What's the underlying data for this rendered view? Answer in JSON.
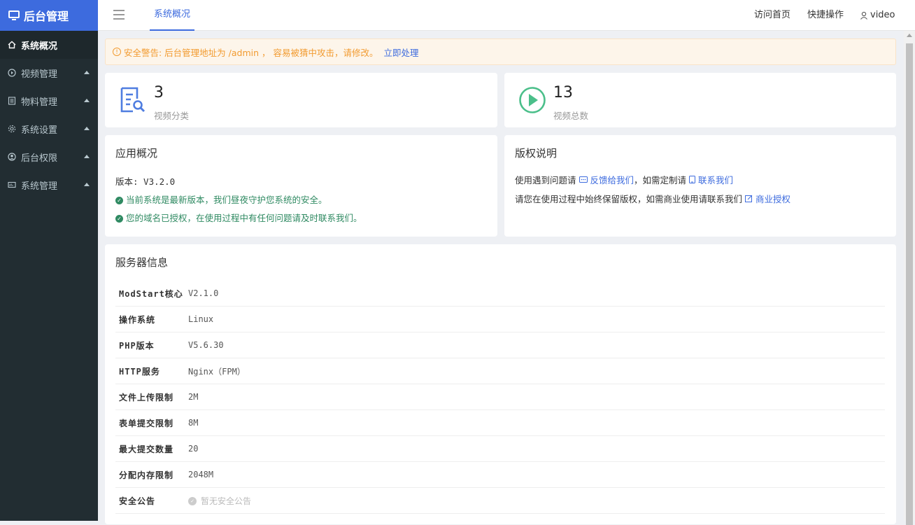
{
  "brand": {
    "title": "后台管理"
  },
  "sidebar": {
    "items": [
      {
        "label": "系统概况",
        "icon": "home-icon",
        "active": true,
        "expandable": false
      },
      {
        "label": "视频管理",
        "icon": "play-circle-icon",
        "active": false,
        "expandable": true
      },
      {
        "label": "物料管理",
        "icon": "list-icon",
        "active": false,
        "expandable": true
      },
      {
        "label": "系统设置",
        "icon": "gear-icon",
        "active": false,
        "expandable": true
      },
      {
        "label": "后台权限",
        "icon": "user-circle-icon",
        "active": false,
        "expandable": true
      },
      {
        "label": "系统管理",
        "icon": "dashboard-icon",
        "active": false,
        "expandable": true
      }
    ]
  },
  "header": {
    "active_tab": "系统概况",
    "visit_home": "访问首页",
    "quick_ops": "快捷操作",
    "username": "video"
  },
  "alert": {
    "text": "安全警告: 后台管理地址为 /admin ， 容易被猜中攻击，请修改。",
    "action": "立即处理"
  },
  "stats": [
    {
      "value": "3",
      "label": "视频分类",
      "icon": "document-search-icon"
    },
    {
      "value": "13",
      "label": "视频总数",
      "icon": "play-circle-icon"
    }
  ],
  "app_overview": {
    "title": "应用概况",
    "version": "版本: V3.2.0",
    "msg1": "当前系统是最新版本，我们昼夜守护您系统的安全。",
    "msg2": "您的域名已授权，在使用过程中有任何问题请及时联系我们。"
  },
  "copyright": {
    "title": "版权说明",
    "line1_prefix": "使用遇到问题请",
    "feedback": "反馈给我们",
    "line1_mid": "，如需定制请",
    "contact": "联系我们",
    "line2_prefix": "请您在使用过程中始终保留版权，如需商业使用请联系我们",
    "license": "商业授权"
  },
  "server": {
    "title": "服务器信息",
    "rows": [
      {
        "key": "ModStart核心",
        "value": "V2.1.0"
      },
      {
        "key": "操作系统",
        "value": "Linux"
      },
      {
        "key": "PHP版本",
        "value": "V5.6.30"
      },
      {
        "key": "HTTP服务",
        "value": "Nginx（FPM）"
      },
      {
        "key": "文件上传限制",
        "value": "2M"
      },
      {
        "key": "表单提交限制",
        "value": "8M"
      },
      {
        "key": "最大提交数量",
        "value": "20"
      },
      {
        "key": "分配内存限制",
        "value": "2048M"
      },
      {
        "key": "安全公告",
        "value": "暂无安全公告"
      }
    ]
  },
  "colors": {
    "accent": "#3d6bde",
    "sidebar": "#222d32",
    "warning": "#f29b30",
    "success": "#2f8a62"
  }
}
